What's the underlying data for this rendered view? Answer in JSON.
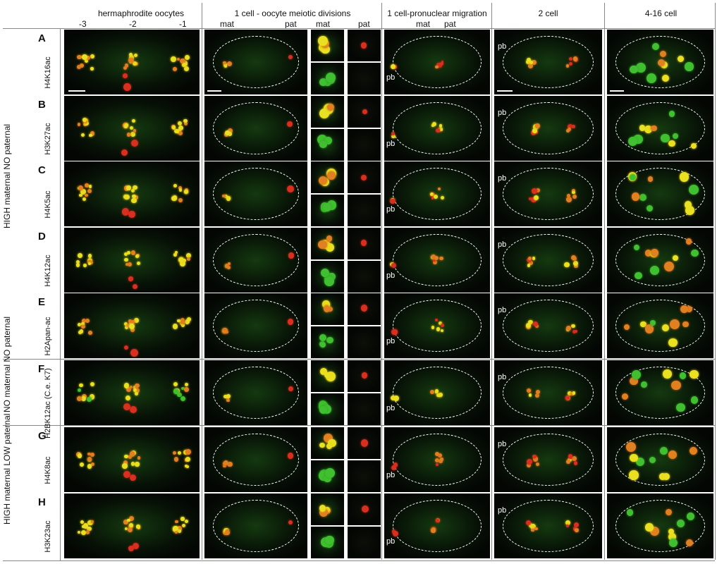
{
  "columns": {
    "oocytes": "hermaphrodite oocytes",
    "meiotic": "1 cell - oocyte meiotic divisions",
    "pronuclear": "1 cell-pronuclear migration",
    "two_cell": "2 cell",
    "multi_cell": "4-16 cell"
  },
  "oocyte_positions": [
    "-3",
    "-2",
    "-1"
  ],
  "parent_labels": {
    "meiotic_mat": "mat",
    "meiotic_pat": "pat",
    "inset_mat": "mat",
    "inset_pat": "pat",
    "pronuclear_mat": "mat",
    "pronuclear_pat": "pat"
  },
  "groups": [
    "HIGH maternal NO paternal",
    "NO maternal NO paternal",
    "HIGH maternal LOW paternal"
  ],
  "rows": [
    {
      "letter": "A",
      "mark": "H4K16ac"
    },
    {
      "letter": "B",
      "mark": "H3K27ac"
    },
    {
      "letter": "C",
      "mark": "H4K5ac"
    },
    {
      "letter": "D",
      "mark": "H4K12ac"
    },
    {
      "letter": "E",
      "mark": "H2Apan-ac"
    },
    {
      "letter": "F",
      "mark": "H2BK12ac (C.e. K7)"
    },
    {
      "letter": "G",
      "mark": "H4K8ac"
    },
    {
      "letter": "H",
      "mark": "H3K23ac"
    }
  ],
  "pb_label": "pb",
  "colors": {
    "background": "#040604",
    "green_channel": "#40c030",
    "red_channel": "#d83020",
    "merge_yellow": "#e8e020",
    "outline": "#ffffff"
  }
}
